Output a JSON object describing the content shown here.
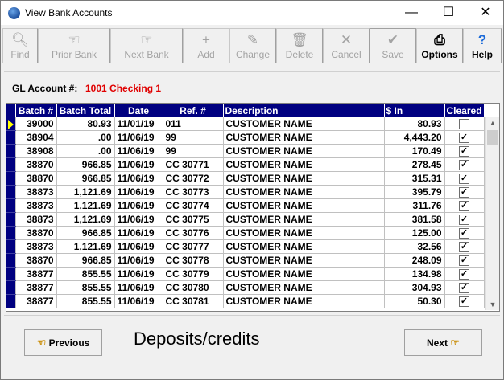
{
  "window": {
    "title": "View Bank Accounts",
    "minimize_label": "—",
    "maximize_label": "☐",
    "close_label": "✕"
  },
  "toolbar": {
    "find": "Find",
    "prior_bank": "Prior Bank",
    "next_bank": "Next Bank",
    "add": "Add",
    "change": "Change",
    "delete": "Delete",
    "cancel": "Cancel",
    "save": "Save",
    "options": "Options",
    "help": "Help"
  },
  "gl": {
    "label": "GL Account #:",
    "value": "1001 Checking 1"
  },
  "table": {
    "headers": [
      "Batch #",
      "Batch Total",
      "Date",
      "Ref. #",
      "Description",
      "$ In",
      "Cleared"
    ],
    "rows": [
      {
        "batch": "39000",
        "total": "80.93",
        "date": "11/01/19",
        "ref": "011",
        "desc": "CUSTOMER NAME",
        "amount": "80.93",
        "cleared": false
      },
      {
        "batch": "38904",
        "total": ".00",
        "date": "11/06/19",
        "ref": "99",
        "desc": "CUSTOMER NAME",
        "amount": "4,443.20",
        "cleared": true
      },
      {
        "batch": "38908",
        "total": ".00",
        "date": "11/06/19",
        "ref": "99",
        "desc": "CUSTOMER NAME",
        "amount": "170.49",
        "cleared": true
      },
      {
        "batch": "38870",
        "total": "966.85",
        "date": "11/06/19",
        "ref": "CC 30771",
        "desc": "CUSTOMER NAME",
        "amount": "278.45",
        "cleared": true
      },
      {
        "batch": "38870",
        "total": "966.85",
        "date": "11/06/19",
        "ref": "CC 30772",
        "desc": "CUSTOMER NAME",
        "amount": "315.31",
        "cleared": true
      },
      {
        "batch": "38873",
        "total": "1,121.69",
        "date": "11/06/19",
        "ref": "CC 30773",
        "desc": "CUSTOMER NAME",
        "amount": "395.79",
        "cleared": true
      },
      {
        "batch": "38873",
        "total": "1,121.69",
        "date": "11/06/19",
        "ref": "CC 30774",
        "desc": "CUSTOMER NAME",
        "amount": "311.76",
        "cleared": true
      },
      {
        "batch": "38873",
        "total": "1,121.69",
        "date": "11/06/19",
        "ref": "CC 30775",
        "desc": "CUSTOMER NAME",
        "amount": "381.58",
        "cleared": true
      },
      {
        "batch": "38870",
        "total": "966.85",
        "date": "11/06/19",
        "ref": "CC 30776",
        "desc": "CUSTOMER NAME",
        "amount": "125.00",
        "cleared": true
      },
      {
        "batch": "38873",
        "total": "1,121.69",
        "date": "11/06/19",
        "ref": "CC 30777",
        "desc": "CUSTOMER NAME",
        "amount": "32.56",
        "cleared": true
      },
      {
        "batch": "38870",
        "total": "966.85",
        "date": "11/06/19",
        "ref": "CC 30778",
        "desc": "CUSTOMER NAME",
        "amount": "248.09",
        "cleared": true
      },
      {
        "batch": "38877",
        "total": "855.55",
        "date": "11/06/19",
        "ref": "CC 30779",
        "desc": "CUSTOMER NAME",
        "amount": "134.98",
        "cleared": true
      },
      {
        "batch": "38877",
        "total": "855.55",
        "date": "11/06/19",
        "ref": "CC 30780",
        "desc": "CUSTOMER NAME",
        "amount": "304.93",
        "cleared": true
      },
      {
        "batch": "38877",
        "total": "855.55",
        "date": "11/06/19",
        "ref": "CC 30781",
        "desc": "CUSTOMER NAME",
        "amount": "50.30",
        "cleared": true
      }
    ]
  },
  "footer": {
    "previous": "Previous",
    "next": "Next",
    "mode_label": "Deposits/credits"
  },
  "colors": {
    "header_bg": "#000080",
    "gl_value": "#e00000",
    "current_row_marker": "#ffff00"
  },
  "icons": {
    "app": "bank-app-icon",
    "find": "magnifier-icon",
    "prior_bank": "hand-left-icon",
    "next_bank": "hand-right-icon",
    "add": "plus-icon",
    "change": "edit-document-icon",
    "delete": "trash-icon",
    "cancel": "x-icon",
    "save": "checkmark-icon",
    "options": "printer-icon",
    "help": "question-icon"
  }
}
